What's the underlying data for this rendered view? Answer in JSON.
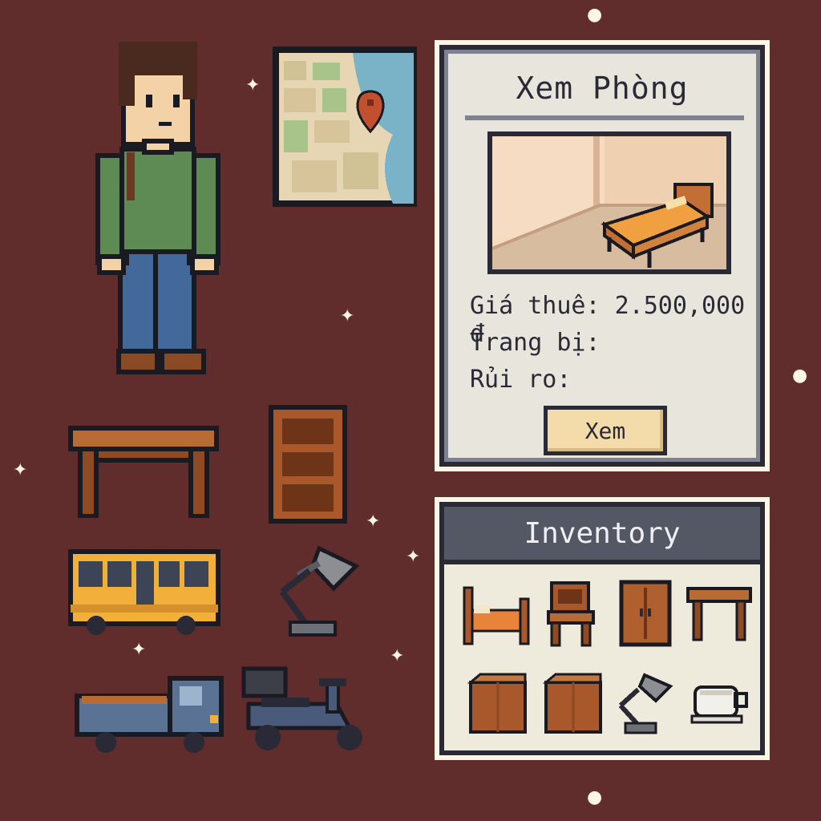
{
  "room_panel": {
    "title": "Xem Phòng",
    "price_label": "Giá thuê: 2.500,000 đ",
    "equipment_label": "Trang bị:",
    "risk_label": "Rủi ro:",
    "view_button": "Xem"
  },
  "inventory": {
    "title": "Inventory",
    "items": [
      "bed",
      "chair",
      "wardrobe",
      "table",
      "box",
      "box",
      "desk-lamp",
      "teacup"
    ]
  },
  "sprites": [
    "character",
    "city-map",
    "table",
    "bookshelf",
    "bus",
    "desk-lamp",
    "truck",
    "scooter"
  ],
  "colors": {
    "background": "#602c2c",
    "panel": "#e8e6dc",
    "panel_border": "#2a2a36",
    "button": "#f3dcaa",
    "inventory_header": "#545865",
    "wood": "#a8582a",
    "outline": "#fdf5e6"
  }
}
